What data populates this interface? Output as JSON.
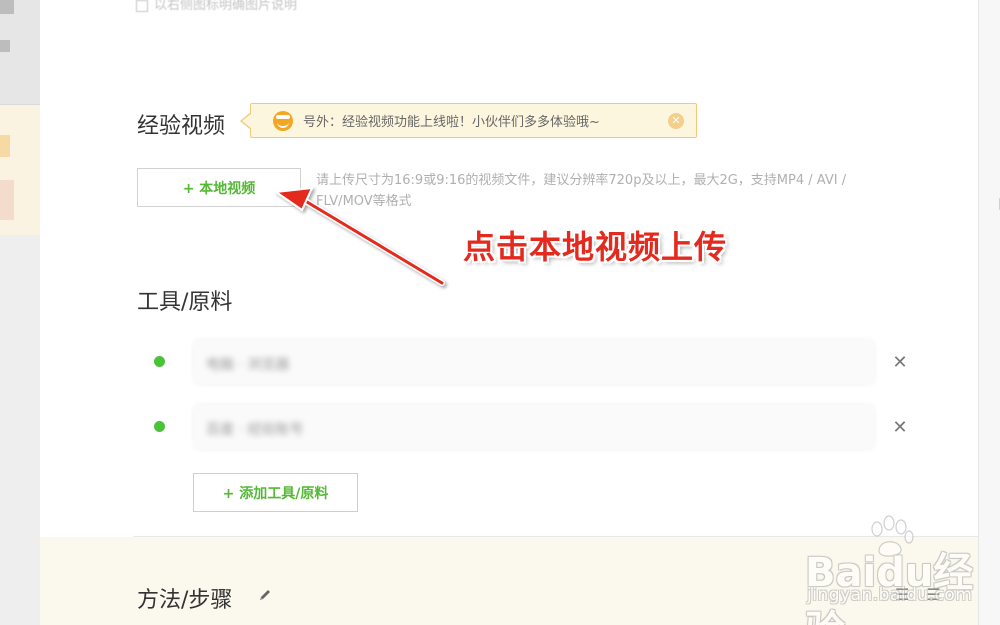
{
  "top_hint": "以右侧图标明确图片说明",
  "video_section": {
    "title": "经验视频",
    "tip_text": "号外：经验视频功能上线啦！小伙伴们多多体验哦~",
    "tip_close_glyph": "✕",
    "upload_button": "+ 本地视频",
    "upload_hint": "请上传尺寸为16:9或9:16的视频文件，建议分辨率720p及以上，最大2G，支持MP4 / AVI / FLV/MOV等格式"
  },
  "annotation": "点击本地视频上传",
  "tools_section": {
    "title": "工具/原料",
    "items": [
      {
        "text": "电脑 · 浏览器",
        "delete_glyph": "✕"
      },
      {
        "text": "百度 · 经验账号",
        "delete_glyph": "✕"
      }
    ],
    "add_button": "+ 添加工具/原料"
  },
  "steps_section": {
    "title": "方法/步骤",
    "icons": "☰ ☰"
  },
  "watermark": {
    "brand": "Baidu经验",
    "url": "jingyan.baidu.com"
  },
  "colors": {
    "green": "#55b836",
    "bullet": "#4cc23a",
    "annotation_red": "#e42a1e",
    "tip_bg": "#fdf6df",
    "tip_border": "#f0c97a"
  }
}
